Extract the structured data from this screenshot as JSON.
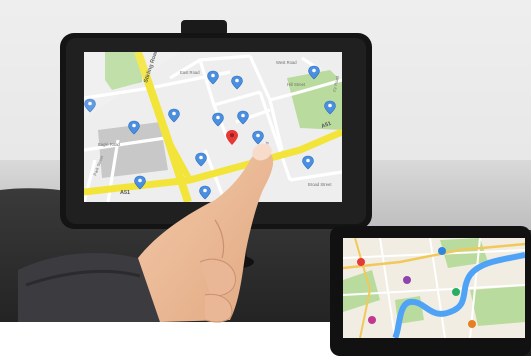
{
  "photo": {
    "main_device": {
      "type": "car-gps-navigator",
      "map_labels": {
        "highway_top": "Stirling Road",
        "highway_bottom": "A51",
        "highway_right": "A51",
        "street_1": "Eagle Road",
        "street_2": "East Road",
        "street_3": "Hill Street",
        "street_4": "Fir Road",
        "street_5": "Park Street",
        "street_6": "Broad Street",
        "street_7": "Elm Road",
        "street_8": "West Road"
      },
      "pins": {
        "blue_count": 14,
        "red_count": 1
      }
    },
    "inset_device": {
      "type": "tablet-map",
      "pins": [
        "red",
        "purple",
        "blue",
        "green",
        "orange",
        "pink"
      ]
    },
    "colors": {
      "map_background": "#eeeeee",
      "park_green": "#b9dc9e",
      "highway_yellow": "#f3e43a",
      "river_blue": "#4fa3f7",
      "pin_blue": "#4a8fe0",
      "pin_red": "#e53935",
      "device_frame": "#141414"
    }
  }
}
